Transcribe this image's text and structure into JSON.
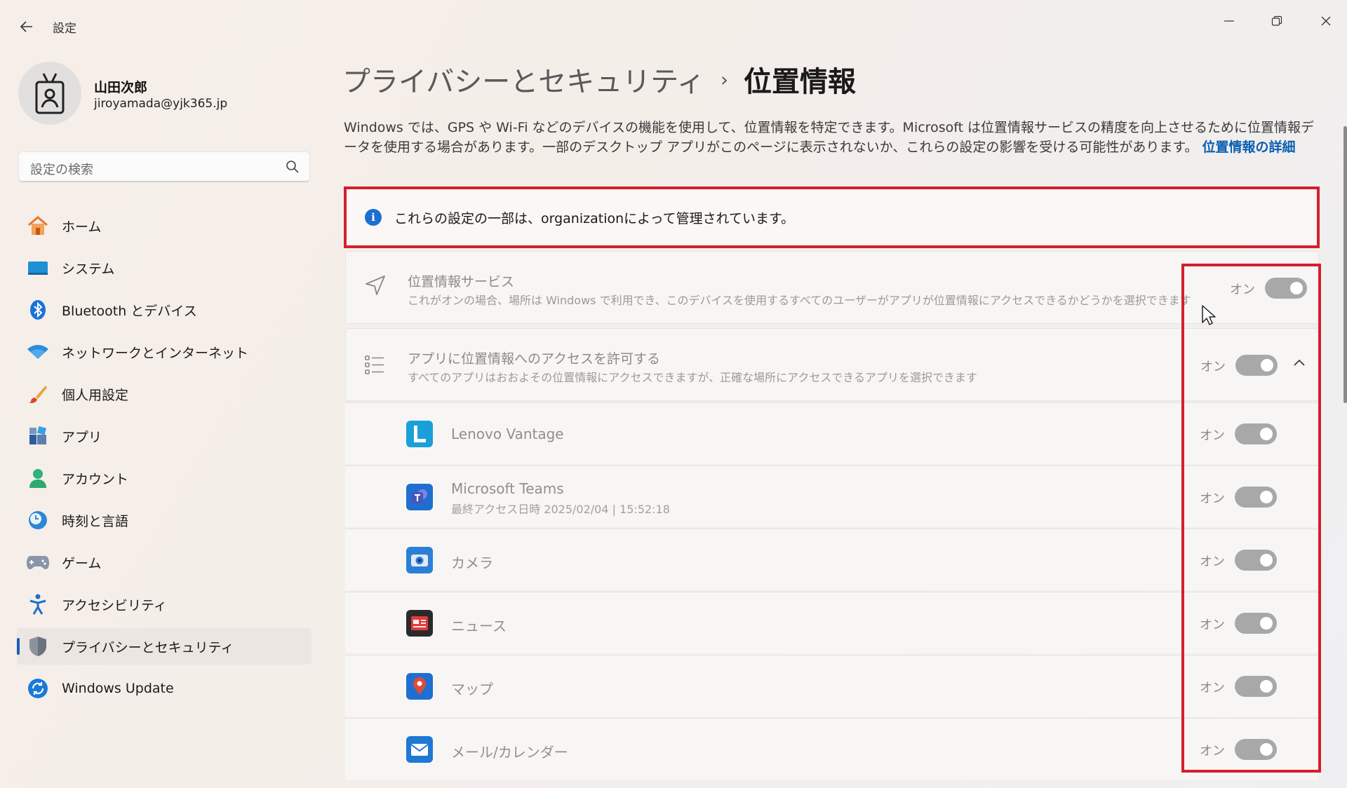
{
  "window": {
    "app_title": "設定"
  },
  "profile": {
    "name": "山田次郎",
    "email": "jiroyamada@yjk365.jp"
  },
  "search": {
    "placeholder": "設定の検索"
  },
  "nav": {
    "items": [
      {
        "label": "ホーム",
        "icon": "home-icon"
      },
      {
        "label": "システム",
        "icon": "system-icon"
      },
      {
        "label": "Bluetooth とデバイス",
        "icon": "bluetooth-icon"
      },
      {
        "label": "ネットワークとインターネット",
        "icon": "wifi-icon"
      },
      {
        "label": "個人用設定",
        "icon": "brush-icon"
      },
      {
        "label": "アプリ",
        "icon": "apps-icon"
      },
      {
        "label": "アカウント",
        "icon": "account-icon"
      },
      {
        "label": "時刻と言語",
        "icon": "clock-globe-icon"
      },
      {
        "label": "ゲーム",
        "icon": "gamepad-icon"
      },
      {
        "label": "アクセシビリティ",
        "icon": "accessibility-icon"
      },
      {
        "label": "プライバシーとセキュリティ",
        "icon": "shield-icon",
        "active": true
      },
      {
        "label": "Windows Update",
        "icon": "update-icon"
      }
    ]
  },
  "breadcrumb": {
    "parent": "プライバシーとセキュリティ",
    "separator": "›",
    "current": "位置情報"
  },
  "description": {
    "text": "Windows では、GPS や Wi-Fi などのデバイスの機能を使用して、位置情報を特定できます。Microsoft は位置情報サービスの精度を向上させるために位置情報データを使用する場合があります。一部のデスクトップ アプリがこのページに表示されないか、これらの設定の影響を受ける可能性があります。",
    "link": "位置情報の詳細"
  },
  "notice": {
    "text": "これらの設定の一部は、organizationによって管理されています。"
  },
  "location_service": {
    "title": "位置情報サービス",
    "subtitle": "これがオンの場合、場所は Windows で利用でき、このデバイスを使用するすべてのユーザーがアプリが位置情報にアクセスできるかどうかを選択できます",
    "toggle_label": "オン"
  },
  "app_access": {
    "title": "アプリに位置情報へのアクセスを許可する",
    "subtitle": "すべてのアプリはおおよその位置情報にアクセスできますが、正確な場所にアクセスできるアプリを選択できます",
    "toggle_label": "オン"
  },
  "apps": [
    {
      "name": "Lenovo Vantage",
      "meta": "",
      "toggle_label": "オン",
      "icon": "lenovo-vantage-icon",
      "color": "#1aa0d8"
    },
    {
      "name": "Microsoft Teams",
      "meta": "最終アクセス日時 2025/02/04 | 15:52:18",
      "toggle_label": "オン",
      "icon": "teams-icon",
      "color": "#4b53bc"
    },
    {
      "name": "カメラ",
      "meta": "",
      "toggle_label": "オン",
      "icon": "camera-icon",
      "color": "#2c7fd6"
    },
    {
      "name": "ニュース",
      "meta": "",
      "toggle_label": "オン",
      "icon": "news-icon",
      "color": "#c42b2b"
    },
    {
      "name": "マップ",
      "meta": "",
      "toggle_label": "オン",
      "icon": "map-pin-icon",
      "color": "#1f6fd0"
    },
    {
      "name": "メール/カレンダー",
      "meta": "",
      "toggle_label": "オン",
      "icon": "mail-icon",
      "color": "#1e78d4"
    }
  ],
  "colors": {
    "highlight_red": "#d3202e",
    "accent_blue": "#1a5fb4",
    "toggle_disabled": "#a8a8a8"
  }
}
